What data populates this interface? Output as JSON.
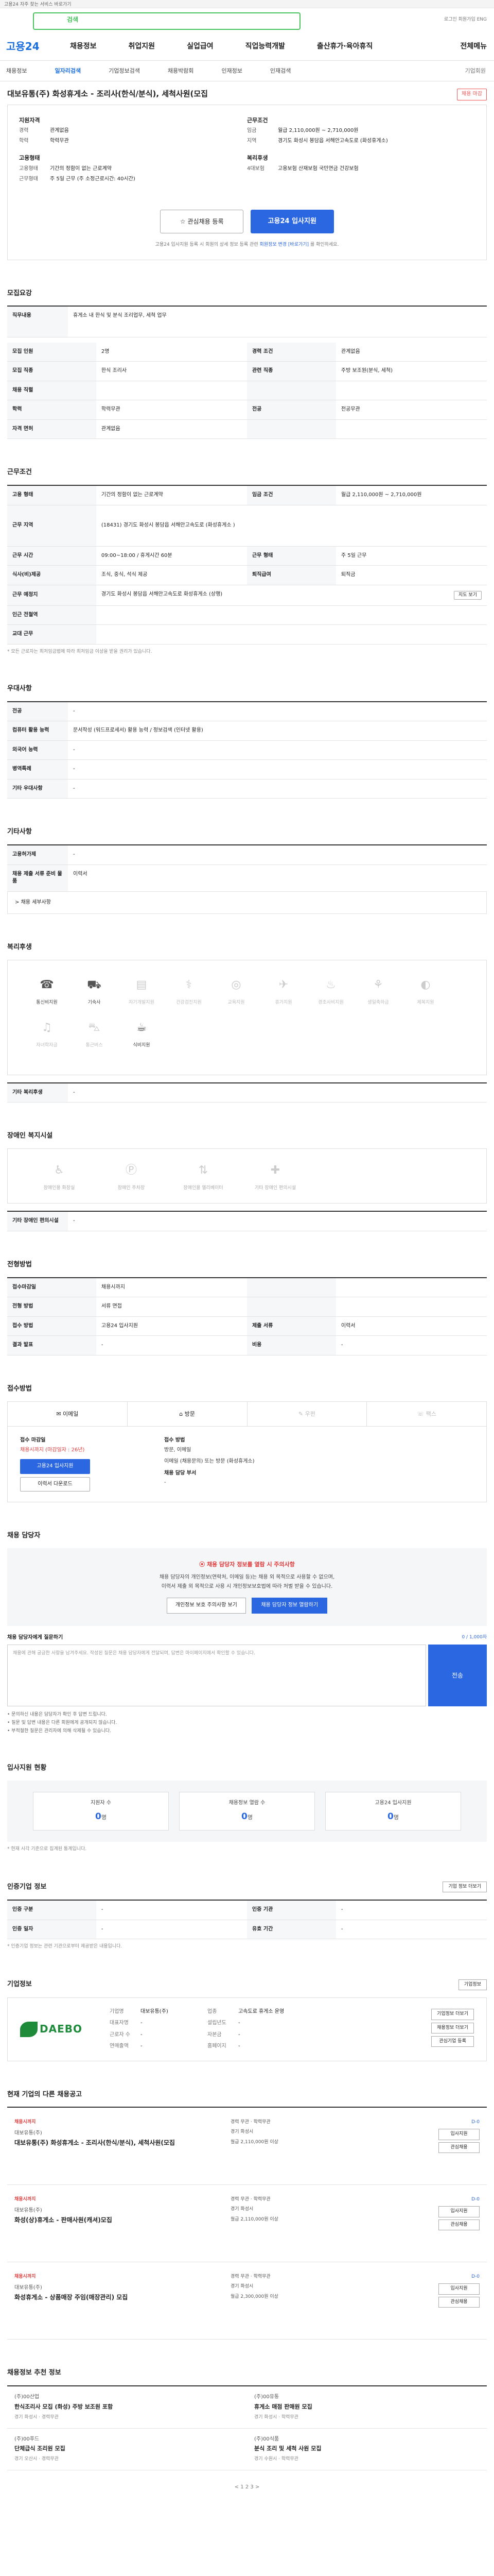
{
  "topbar": {
    "text": "고용24 자주 찾는 서비스 바로가기"
  },
  "search": {
    "placeholder": "",
    "button_label": "검색",
    "login_label": "로그인  회원가입  ENG"
  },
  "header": {
    "logo": "고용24",
    "menu": [
      "채용정보",
      "취업지원",
      "실업급여",
      "직업능력개발",
      "출산휴가·육아휴직"
    ],
    "right": "전체메뉴"
  },
  "subnav": {
    "items": [
      "채용정보",
      "일자리검색",
      "기업정보검색",
      "채용박람회",
      "인재정보",
      "인재검색"
    ],
    "active_index": 1,
    "right": "기업회원"
  },
  "page": {
    "title": "대보유통(주) 화성휴게소 - 조리사(한식/분식), 세척사원(모집",
    "report_label": "채용 마감"
  },
  "summary": {
    "left_header": "지원자격",
    "left_rows": [
      {
        "k": "경력",
        "v": "관계없음"
      },
      {
        "k": "학력",
        "v": "학력무관"
      }
    ],
    "left_header2": "고용형태",
    "left_rows2": [
      {
        "k": "고용형태",
        "v": "기간의 정함이 없는 근로계약"
      },
      {
        "k": "근무형태",
        "v": "주 5일 근무 (주 소정근로시간: 40시간)"
      }
    ],
    "right_header": "근무조건",
    "right_rows": [
      {
        "k": "임금",
        "v": "월급 2,110,000원 ~ 2,710,000원"
      },
      {
        "k": "지역",
        "v": "경기도 화성시 봉담읍 서해안고속도로 (화성휴게소)"
      }
    ],
    "right_header2": "복리후생",
    "right_rows2": [
      {
        "k": "4대보험",
        "v": "고용보험  산재보험  국민연금  건강보험"
      }
    ]
  },
  "actions": {
    "fav": "☆ 관심채용 등록",
    "apply": "고용24 입사지원",
    "note_prefix": "고용24 입사지원 등록 시 회원의 상세 정보 등록 관련",
    "note_link": "회원정보 변경 [바로가기]",
    "note_suffix": "를 확인하세요."
  },
  "sections": {
    "job_desc": {
      "title": "모집요강",
      "rows": [
        {
          "k": "직무내용",
          "v": "휴게소 내 한식 및 분식 조리업무, 세척 업무"
        }
      ],
      "grid": [
        [
          {
            "k": "모집 인원",
            "v": "2명"
          },
          {
            "k": "경력 조건",
            "v": "관계없음"
          }
        ],
        [
          {
            "k": "모집 직종",
            "v": "한식 조리사"
          },
          {
            "k": "관련 직종",
            "v": "주방 보조원(분식, 세척)"
          }
        ],
        [
          {
            "k": "채용 직렬",
            "v": ""
          },
          {
            "k": "",
            "v": ""
          }
        ],
        [
          {
            "k": "학력",
            "v": "학력무관"
          },
          {
            "k": "전공",
            "v": "전공무관"
          }
        ],
        [
          {
            "k": "자격 면허",
            "v": "관계없음"
          },
          {
            "k": "",
            "v": ""
          }
        ]
      ]
    },
    "conditions": {
      "title": "근무조건",
      "rows": [
        {
          "k": "고용 형태",
          "v": "기간의 정함이 없는 근로계약",
          "k2": "임금 조건",
          "v2": "월급 2,110,000원 ~ 2,710,000원"
        },
        {
          "k": "근무 지역",
          "v": "(18431) 경기도 화성시 봉담읍 서해안고속도로 (화성휴게소 )",
          "k2": "",
          "v2": ""
        },
        {
          "k": "근무 시간",
          "v": "09:00~18:00 / 휴게시간 60분",
          "k2": "근무 형태",
          "v2": "주 5일 근무"
        },
        {
          "k": "식사(비)제공",
          "v": "조식, 중식, 석식 제공",
          "k2": "퇴직급여",
          "v2": "퇴직금"
        },
        {
          "k": "근무 예정지",
          "v": "경기도 화성시 봉담읍 서해안고속도로 화성휴게소 (상행)",
          "k2": "",
          "v2": ""
        },
        {
          "k": "인근 전철역",
          "v": "",
          "k2": "",
          "v2": ""
        },
        {
          "k": "교대 근무",
          "v": "",
          "k2": "",
          "v2": ""
        }
      ],
      "map_button": "지도 보기",
      "note": "* 모든 근로자는 최저임금법에 따라 최저임금 이상을 받을 권리가 있습니다."
    },
    "extra": {
      "title": "우대사항",
      "rows": [
        {
          "k": "전공",
          "v": "-"
        },
        {
          "k": "컴퓨터 활용 능력",
          "v": "문서작성 (워드프로세서) 활용 능력 / 정보검색 (인터넷 활용)"
        },
        {
          "k": "외국어 능력",
          "v": "-"
        },
        {
          "k": "병역특례",
          "v": "-"
        },
        {
          "k": "기타 우대사항",
          "v": "-"
        }
      ]
    },
    "other": {
      "title": "기타사항",
      "rows": [
        {
          "k": "고용허가제",
          "v": "-"
        },
        {
          "k": "채용 제출 서류 준비 물품",
          "v": "이력서"
        }
      ],
      "detail": "> 채용 세부사항"
    },
    "welfare": {
      "title": "복리후생",
      "items": [
        {
          "icon": "☎",
          "label": "통신비지원",
          "on": true
        },
        {
          "icon": "⛟",
          "label": "기숙사",
          "on": true
        },
        {
          "icon": "▤",
          "label": "자기개발지원",
          "on": false
        },
        {
          "icon": "⚕",
          "label": "건강검진지원",
          "on": false
        },
        {
          "icon": "◎",
          "label": "교육지원",
          "on": false
        },
        {
          "icon": "✈",
          "label": "휴가지원",
          "on": false
        },
        {
          "icon": "♨",
          "label": "경조사비지원",
          "on": false
        },
        {
          "icon": "⚘",
          "label": "생일축하금",
          "on": false
        },
        {
          "icon": "◐",
          "label": "제복지원",
          "on": false
        },
        {
          "icon": "♫",
          "label": "자녀학자금",
          "on": false
        },
        {
          "icon": "⛍",
          "label": "통근버스",
          "on": false
        },
        {
          "icon": "☕",
          "label": "식비지원",
          "on": true
        }
      ],
      "extra_k": "기타 복리후생",
      "extra_v": "-"
    },
    "disability": {
      "title": "장애인 복지시설",
      "items": [
        "장애인용 화장실",
        "장애인 주차장",
        "장애인용 엘리베이터",
        "기타 장애인 편의시설"
      ],
      "extra_k": "기타 장애인 편의시설",
      "extra_v": "-"
    },
    "recruitment": {
      "title": "전형방법",
      "grid": [
        [
          {
            "k": "접수마감일",
            "v": "채용시까지"
          },
          {
            "k": "",
            "v": ""
          }
        ],
        [
          {
            "k": "전형 방법",
            "v": "서류  면접"
          },
          {
            "k": "",
            "v": ""
          }
        ],
        [
          {
            "k": "접수 방법",
            "v": "고용24 입사지원"
          },
          {
            "k": "제출 서류",
            "v": "이력서"
          }
        ],
        [
          {
            "k": "결과 발표",
            "v": "-"
          },
          {
            "k": "비용",
            "v": "-"
          }
        ]
      ]
    },
    "apply_method": {
      "title": "접수방법",
      "tabs": [
        {
          "label": "이메일",
          "on": true
        },
        {
          "label": "방문",
          "on": true
        },
        {
          "label": "우편",
          "on": false
        },
        {
          "label": "팩스",
          "on": false
        }
      ],
      "c1_h": "접수 마감일",
      "c1_red": "채용시까지 (마감일자 : 26년)",
      "c1_btn": "고용24 입사지원",
      "c1_btn2": "이력서 다운로드",
      "c2_h": "접수 방법",
      "c2_v": "방문, 이메일",
      "c2_v2": "이메일 (채용문의) 또는 방문 (화성휴게소)",
      "c2_h2": "채용 담당 부서",
      "c2_v3": "-"
    },
    "contact": {
      "title": "채용 담당자",
      "red": "⦿ 채용 담당자 정보를 열람 시 주의사항",
      "lines": [
        "채용 담당자의 개인정보(연락처, 이메일 등)는 채용 외 목적으로 사용할 수 없으며,",
        "이력서 제출 외 목적으로 사용 시 개인정보보호법에 따라 처벌 받을 수 있습니다."
      ],
      "btn_outline": "개인정보 보호 주의사항 보기",
      "btn_blue": "채용 담당자 정보 열람하기"
    },
    "inquiry": {
      "label": "채용 담당자에게 질문하기",
      "count": "0 / 1,000자",
      "placeholder": "채용에 관해 궁금한 사항을 남겨주세요. 작성된 질문은 채용 담당자에게 전달되며, 답변은 마이페이지에서 확인할 수 있습니다.",
      "send": "전송",
      "bullets": [
        "• 문의하신 내용은 담당자가 확인 후 답변 드립니다.",
        "• 질문 및 답변 내용은 다른 회원에게 공개되지 않습니다.",
        "• 부적절한 질문은 관리자에 의해 삭제될 수 있습니다."
      ]
    },
    "status": {
      "title": "입사지원 현황",
      "cards": [
        {
          "label": "지원자 수",
          "val": "0",
          "unit": "명"
        },
        {
          "label": "채용정보 열람 수",
          "val": "0",
          "unit": "명"
        },
        {
          "label": "고용24 입사지원",
          "val": "0",
          "unit": "명"
        }
      ],
      "note": "* 현재 시각 기준으로 집계된 통계입니다."
    },
    "cert": {
      "title": "인증기업 정보",
      "btn": "기업 정보 더보기",
      "rows": [
        {
          "k": "인증 구분",
          "v": "-",
          "k2": "인증 기관",
          "v2": "-"
        },
        {
          "k": "인증 일자",
          "v": "-",
          "k2": "유효 기간",
          "v2": "-"
        }
      ],
      "note": "* 인증기업 정보는 관련 기관으로부터 제공받은 내용입니다."
    },
    "company": {
      "title": "기업정보",
      "btn": "기업정보",
      "logo_text": "DAEBO",
      "grid": [
        {
          "k": "기업명",
          "v": "대보유통(주)"
        },
        {
          "k": "업종",
          "v": "고속도로 휴게소 운영"
        },
        {
          "k": "대표자명",
          "v": "-"
        },
        {
          "k": "설립년도",
          "v": "-"
        },
        {
          "k": "근로자 수",
          "v": "-"
        },
        {
          "k": "자본금",
          "v": "-"
        },
        {
          "k": "연매출액",
          "v": "-"
        },
        {
          "k": "홈페이지",
          "v": "-"
        }
      ],
      "side_btns": [
        "기업정보 더보기",
        "채용정보 더보기",
        "관심기업 등록"
      ]
    },
    "others": {
      "title": "현재 기업의 다른 채용공고",
      "jobs": [
        {
          "red": "채용시까지",
          "co": "대보유통(주)",
          "title": "대보유통(주) 화성휴게소 - 조리사(한식/분식), 세척사원(모집",
          "mid": [
            "경력 무관 · 학력무관",
            "경기 화성시",
            "월급 2,110,000원 이상"
          ],
          "d": "D-0",
          "b": [
            "입사지원",
            "관심채용"
          ]
        },
        {
          "red": "채용시까지",
          "co": "대보유통(주)",
          "title": "화성(상)휴게소 - 판매사원(캐셔)모집",
          "mid": [
            "경력 무관 · 학력무관",
            "경기 화성시",
            "월급 2,110,000원 이상"
          ],
          "d": "D-0",
          "b": [
            "입사지원",
            "관심채용"
          ]
        },
        {
          "red": "채용시까지",
          "co": "대보유통(주)",
          "title": "화성휴게소 - 상품매장 주임(매장관리) 모집",
          "mid": [
            "경력 무관 · 학력무관",
            "경기 화성시",
            "월급 2,300,000원 이상"
          ],
          "d": "D-0",
          "b": [
            "입사지원",
            "관심채용"
          ]
        }
      ]
    },
    "recommend": {
      "title": "채용정보 추천 정보",
      "items": [
        {
          "co": "(주)00산업",
          "t": "한식조리사 모집 (화성) 주방 보조원 포함",
          "m": "경기 화성시 · 경력무관"
        },
        {
          "co": "(주)00유통",
          "t": "휴게소 매점 판매원 모집",
          "m": "경기 화성시 · 학력무관"
        },
        {
          "co": "(주)00푸드",
          "t": "단체급식 조리원 모집",
          "m": "경기 오산시 · 경력무관"
        },
        {
          "co": "(주)00식품",
          "t": "분식 조리 및 세척 사원 모집",
          "m": "경기 수원시 · 학력무관"
        }
      ],
      "pager": "< 1 2 3 >"
    }
  }
}
